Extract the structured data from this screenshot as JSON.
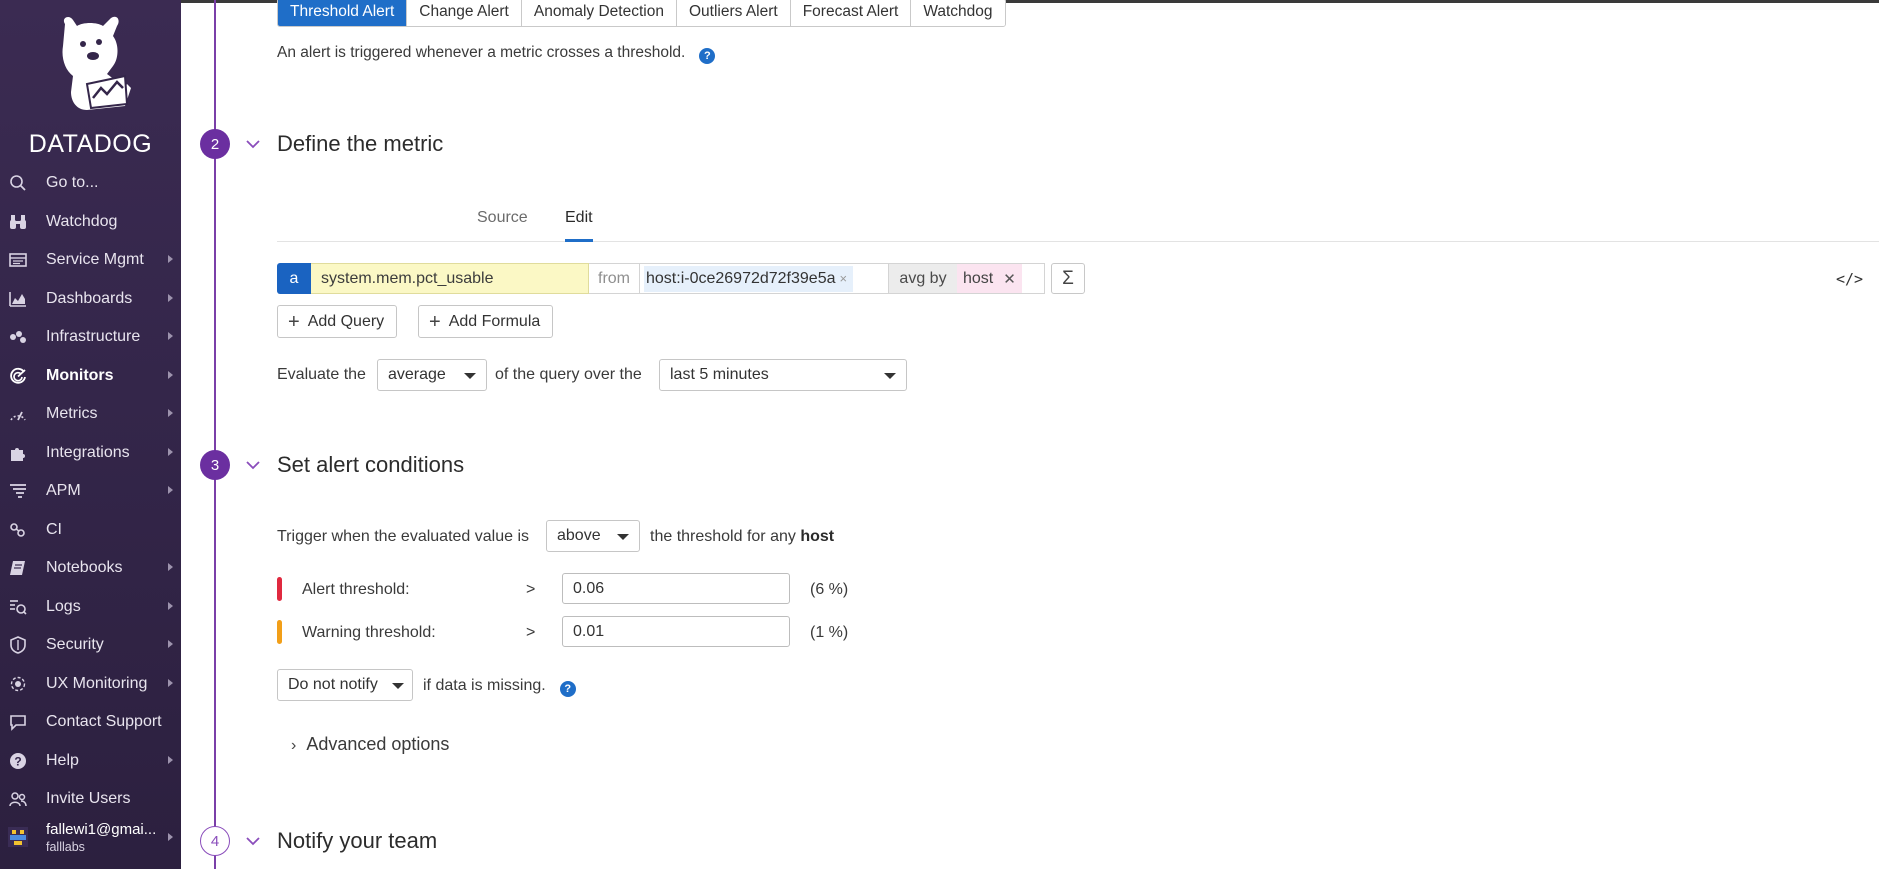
{
  "sidebar": {
    "logo_text": "DATADOG",
    "items": [
      {
        "label": "Go to...",
        "icon": "search-icon",
        "caret": false
      },
      {
        "label": "Watchdog",
        "icon": "binoculars-icon",
        "caret": false
      },
      {
        "label": "Service Mgmt",
        "icon": "service-icon",
        "caret": true
      },
      {
        "label": "Dashboards",
        "icon": "dashboard-icon",
        "caret": true
      },
      {
        "label": "Infrastructure",
        "icon": "infrastructure-icon",
        "caret": true
      },
      {
        "label": "Monitors",
        "icon": "monitors-icon",
        "caret": true,
        "active": true
      },
      {
        "label": "Metrics",
        "icon": "metrics-icon",
        "caret": true
      },
      {
        "label": "Integrations",
        "icon": "puzzle-icon",
        "caret": true
      },
      {
        "label": "APM",
        "icon": "apm-icon",
        "caret": true
      },
      {
        "label": "CI",
        "icon": "ci-icon",
        "caret": false
      },
      {
        "label": "Notebooks",
        "icon": "notebook-icon",
        "caret": true
      },
      {
        "label": "Logs",
        "icon": "logs-icon",
        "caret": true
      },
      {
        "label": "Security",
        "icon": "shield-icon",
        "caret": true
      },
      {
        "label": "UX Monitoring",
        "icon": "ux-icon",
        "caret": true
      },
      {
        "label": "Contact Support",
        "icon": "chat-icon",
        "caret": false
      },
      {
        "label": "Help",
        "icon": "help-icon",
        "caret": true
      },
      {
        "label": "Invite Users",
        "icon": "users-icon",
        "caret": false
      }
    ],
    "user": {
      "name": "fallewi1@gmai...",
      "org": "falllabs"
    }
  },
  "monitor_types": [
    "Threshold Alert",
    "Change Alert",
    "Anomaly Detection",
    "Outliers Alert",
    "Forecast Alert",
    "Watchdog"
  ],
  "description": "An alert is triggered whenever a metric crosses a threshold.",
  "steps": {
    "s2": {
      "number": "2",
      "title": "Define the metric"
    },
    "s3": {
      "number": "3",
      "title": "Set alert conditions"
    },
    "s4": {
      "number": "4",
      "title": "Notify your team"
    }
  },
  "metric_tabs": {
    "source": "Source",
    "edit": "Edit",
    "active": "Edit"
  },
  "query": {
    "letter": "a",
    "metric": "system.mem.pct_usable",
    "from_label": "from",
    "host": "host:i-0ce26972d72f39e5a",
    "host_remove": "×",
    "avg_by_label": "avg by",
    "group": "host",
    "group_remove": "✕",
    "sigma": "Σ",
    "code_toggle": "</>"
  },
  "buttons": {
    "add_query": "Add Query",
    "add_formula": "Add Formula"
  },
  "evaluate": {
    "prefix": "Evaluate the",
    "aggregation": "average",
    "middle": "of the query over the",
    "window": "last 5 minutes"
  },
  "conditions": {
    "trigger_prefix": "Trigger when the evaluated value is",
    "comparator": "above",
    "trigger_suffix": "the threshold for any",
    "trigger_group": "host",
    "alert": {
      "label": "Alert threshold:",
      "op": ">",
      "value": "0.06",
      "pct": "(6 %)",
      "color": "#e0293f"
    },
    "warning": {
      "label": "Warning threshold:",
      "op": ">",
      "value": "0.01",
      "pct": "(1 %)",
      "color": "#f29f18"
    },
    "nodata_select": "Do not notify",
    "nodata_suffix": "if data is missing.",
    "advanced": "Advanced options"
  },
  "colors": {
    "accent": "#1f6ec8",
    "step": "#6b2fa0",
    "sidebar": "#34264a"
  }
}
